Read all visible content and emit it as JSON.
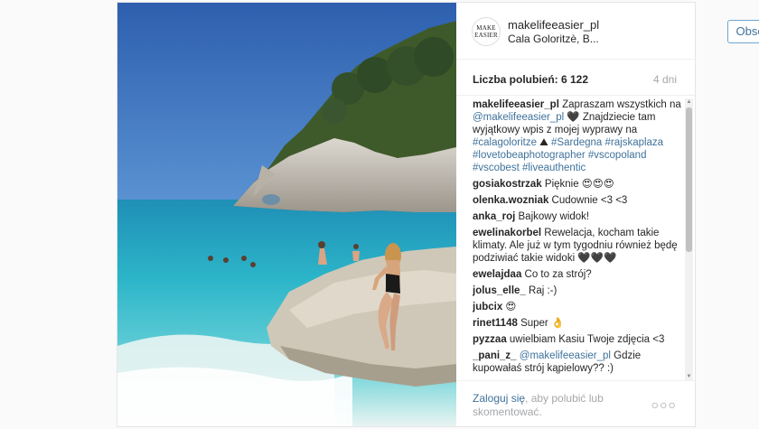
{
  "post": {
    "username": "makelifeeasier_pl",
    "location": "Cala Goloritzè, B...",
    "follow_label": "Obserwuj",
    "avatar_text_top": "MAKE",
    "avatar_text_bottom": "EASIER",
    "likes": "Liczba polubień: 6 122",
    "age": "4 dni"
  },
  "caption": {
    "user": "makelifeeasier_pl",
    "text_1": " Zapraszam wszystkich na ",
    "mention": "@makelifeeasier_pl",
    "text_2": " 🖤 Znajdziecie tam wyjątkowy wpis z mojej wyprawy na ",
    "tag_1": "#calagoloritze",
    "text_3": " ⛰ ",
    "tag_2": "#Sardegna",
    "tag_3": "#rajskaplaza",
    "tag_4": "#lovetobeaphotographer",
    "tag_5": "#vscopoland",
    "tag_6": "#vscobest",
    "tag_7": "#liveauthentic"
  },
  "comments": [
    {
      "user": "gosiakostrzak",
      "text": " Pięknie 😍😍😍"
    },
    {
      "user": "olenka.wozniak",
      "text": " Cudownie <3 <3"
    },
    {
      "user": "anka_roj",
      "text": " Bajkowy widok!"
    },
    {
      "user": "ewelinakorbel",
      "text": " Rewelacja, kocham takie klimaty. Ale już w tym tygodniu również będę podziwiać takie widoki 🖤🖤🖤"
    },
    {
      "user": "ewelajdaa",
      "text": " Co to za strój?"
    },
    {
      "user": "jolus_elle_",
      "text": " Raj :-)"
    },
    {
      "user": "jubcix",
      "text": " 😍"
    },
    {
      "user": "rinet1148",
      "text": " Super 👌"
    },
    {
      "user": "pyzzaa",
      "text": " uwielbiam Kasiu Twoje zdjęcia <3"
    },
    {
      "user": "_pani_z_",
      "mention": "@makelifeeasier_pl",
      "text": " Gdzie kupowałaś strój kąpielowy?? :)"
    }
  ],
  "footer": {
    "login": "Zaloguj się",
    "rest": ", aby polubić lub skomentować.",
    "more": "○○○"
  },
  "colors": {
    "link": "#3f729b",
    "muted": "#a5a7aa",
    "sea": "#2fb4c6",
    "sky": "#2f66b0"
  },
  "icons": {
    "more": "more-options-icon",
    "scroll_up": "scroll-up-arrow-icon",
    "scroll_down": "scroll-down-arrow-icon"
  }
}
